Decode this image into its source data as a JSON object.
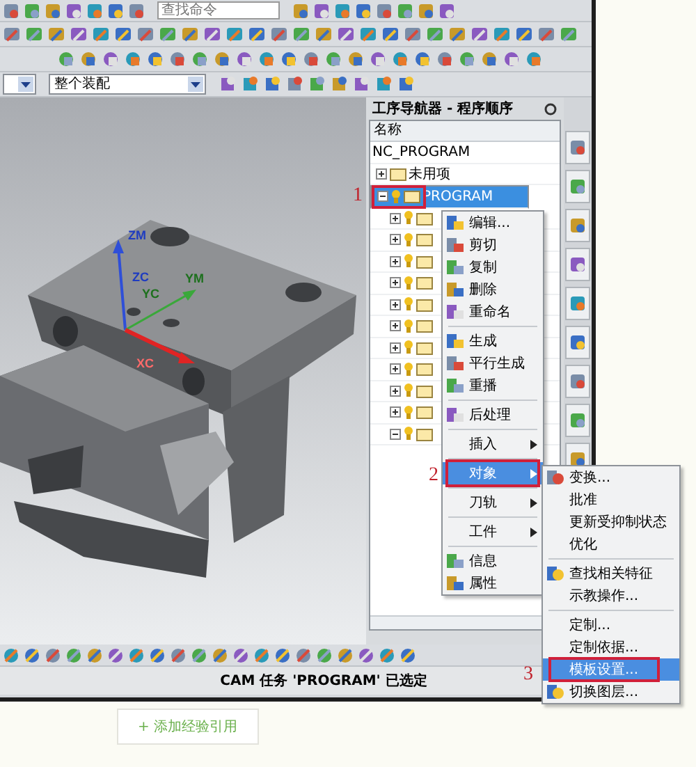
{
  "toolbar": {
    "search": {
      "placeholder": "查找命令"
    },
    "assembly_select": {
      "value": "整个装配"
    }
  },
  "viewport": {
    "axes": [
      {
        "label": "ZM",
        "color": "#1f3cc0"
      },
      {
        "label": "ZC",
        "color": "#1f3cc0"
      },
      {
        "label": "YM",
        "color": "#1d701d"
      },
      {
        "label": "YC",
        "color": "#1d701d"
      },
      {
        "label": "XC",
        "color": "#ff6a6a"
      }
    ]
  },
  "navigator": {
    "title": "工序导航器 - 程序顺序",
    "column": "名称",
    "tree": [
      {
        "label": "NC_PROGRAM",
        "selected": false,
        "children": [
          {
            "label": "未用项",
            "expanded": false,
            "selected": false
          },
          {
            "label": "PROGRAM",
            "expanded": true,
            "selected": true,
            "children": [
              {
                "expanded": false,
                "selected": false
              },
              {
                "expanded": false,
                "selected": false
              },
              {
                "expanded": false,
                "selected": false
              },
              {
                "expanded": false,
                "selected": false
              },
              {
                "expanded": false,
                "selected": false
              },
              {
                "expanded": false,
                "selected": false
              },
              {
                "expanded": false,
                "selected": false
              },
              {
                "expanded": false,
                "selected": false
              },
              {
                "expanded": false,
                "selected": false
              },
              {
                "expanded": false,
                "selected": false
              },
              {
                "expanded": true,
                "selected": false
              }
            ]
          }
        ]
      }
    ]
  },
  "context_menu": {
    "items": [
      {
        "kind": "command",
        "label": "编辑...",
        "selected": false
      },
      {
        "kind": "command",
        "label": "剪切",
        "selected": false
      },
      {
        "kind": "command",
        "label": "复制",
        "selected": false
      },
      {
        "kind": "command",
        "label": "删除",
        "selected": false
      },
      {
        "kind": "command",
        "label": "重命名",
        "selected": false
      },
      {
        "kind": "separator"
      },
      {
        "kind": "command",
        "label": "生成",
        "selected": false
      },
      {
        "kind": "command",
        "label": "平行生成",
        "selected": false
      },
      {
        "kind": "command",
        "label": "重播",
        "selected": false
      },
      {
        "kind": "separator"
      },
      {
        "kind": "command",
        "label": "后处理",
        "selected": false
      },
      {
        "kind": "separator"
      },
      {
        "kind": "submenu",
        "label": "插入",
        "selected": false
      },
      {
        "kind": "separator"
      },
      {
        "kind": "submenu",
        "label": "对象",
        "selected": true
      },
      {
        "kind": "separator"
      },
      {
        "kind": "submenu",
        "label": "刀轨",
        "selected": false
      },
      {
        "kind": "separator"
      },
      {
        "kind": "submenu",
        "label": "工件",
        "selected": false
      },
      {
        "kind": "separator"
      },
      {
        "kind": "command",
        "label": "信息",
        "selected": false
      },
      {
        "kind": "command",
        "label": "属性",
        "selected": false
      }
    ]
  },
  "submenu": {
    "items": [
      {
        "kind": "command",
        "label": "变换...",
        "selected": false
      },
      {
        "kind": "plain",
        "label": "批准",
        "selected": false
      },
      {
        "kind": "plain",
        "label": "更新受抑制状态",
        "selected": false
      },
      {
        "kind": "plain",
        "label": "优化",
        "selected": false
      },
      {
        "kind": "separator"
      },
      {
        "kind": "command",
        "label": "查找相关特征",
        "selected": false
      },
      {
        "kind": "plain",
        "label": "示教操作...",
        "selected": false
      },
      {
        "kind": "separator"
      },
      {
        "kind": "plain",
        "label": "定制...",
        "selected": false
      },
      {
        "kind": "plain",
        "label": "定制依据...",
        "selected": false
      },
      {
        "kind": "plain",
        "label": "模板设置...",
        "selected": true
      },
      {
        "kind": "command",
        "label": "切换图层...",
        "selected": false
      }
    ]
  },
  "annotations": [
    "1",
    "2",
    "3"
  ],
  "status_bar": "CAM 任务 'PROGRAM' 已选定",
  "page_button": "+ 添加经验引用"
}
